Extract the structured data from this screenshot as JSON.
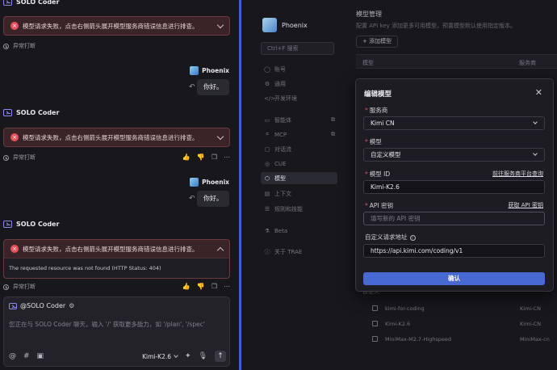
{
  "chat": {
    "agent_name": "SOLO Coder",
    "error_message": "模型请求失败，点击右侧箭头展开模型服务商错误信息进行排查。",
    "error_detail": "The requested resource was not found (HTTP Status: 404)",
    "abnormal_label": "异常打断",
    "user_name": "Phoenix",
    "user_message": "你好。",
    "input": {
      "agent_tag": "@SOLO Coder",
      "placeholder": "您正在与 SOLO Coder 聊天，输入 '/' 获取更多能力，如 '/plan', '/spec'",
      "model": "Kimi-K2.6"
    }
  },
  "settings_nav": {
    "profile_name": "Phoenix",
    "search_placeholder": "Ctrl+F 搜索",
    "items": [
      {
        "label": "账号",
        "icon": "user-icon"
      },
      {
        "label": "通用",
        "icon": "gear-icon"
      },
      {
        "label": "开发环境",
        "icon": "code-icon"
      },
      {
        "label": "智能体",
        "icon": "agent-icon"
      },
      {
        "label": "MCP",
        "icon": "mcp-icon"
      },
      {
        "label": "对话流",
        "icon": "flow-icon"
      },
      {
        "label": "CUE",
        "icon": "cue-icon"
      },
      {
        "label": "模型",
        "icon": "model-icon"
      },
      {
        "label": "上下文",
        "icon": "context-icon"
      },
      {
        "label": "规则和技能",
        "icon": "rules-icon"
      },
      {
        "label": "Beta",
        "icon": "beta-icon"
      },
      {
        "label": "关于 TRAE",
        "icon": "info-icon"
      }
    ]
  },
  "model_mgmt": {
    "title": "模型管理",
    "desc": "配置 API key 添加更多可用模型，预置模型默认使用指定版本。",
    "add_button": "+ 添加模型",
    "col_model": "模型",
    "col_provider": "服务商",
    "section_custom": "自定义",
    "rows": [
      {
        "name": "kimi-for-coding",
        "provider": "Kimi-CN"
      },
      {
        "name": "Kimi-K2.6",
        "provider": "Kimi-CN"
      },
      {
        "name": "MiniMax-M2.7-Highspeed",
        "provider": "MiniMax-cn"
      }
    ]
  },
  "modal": {
    "title": "编辑模型",
    "provider_label": "服务商",
    "provider_value": "Kimi CN",
    "model_label": "模型",
    "model_value": "自定义模型",
    "model_id_label": "模型 ID",
    "model_id_link": "前往服务商平台查询",
    "model_id_value": "Kimi-K2.6",
    "api_key_label": "API 密钥",
    "api_key_link": "获取 API 密钥",
    "api_key_placeholder": "填写新的 API 密钥",
    "base_url_label": "自定义请求地址",
    "base_url_value": "https://api.kimi.com/coding/v1",
    "confirm": "确认"
  }
}
